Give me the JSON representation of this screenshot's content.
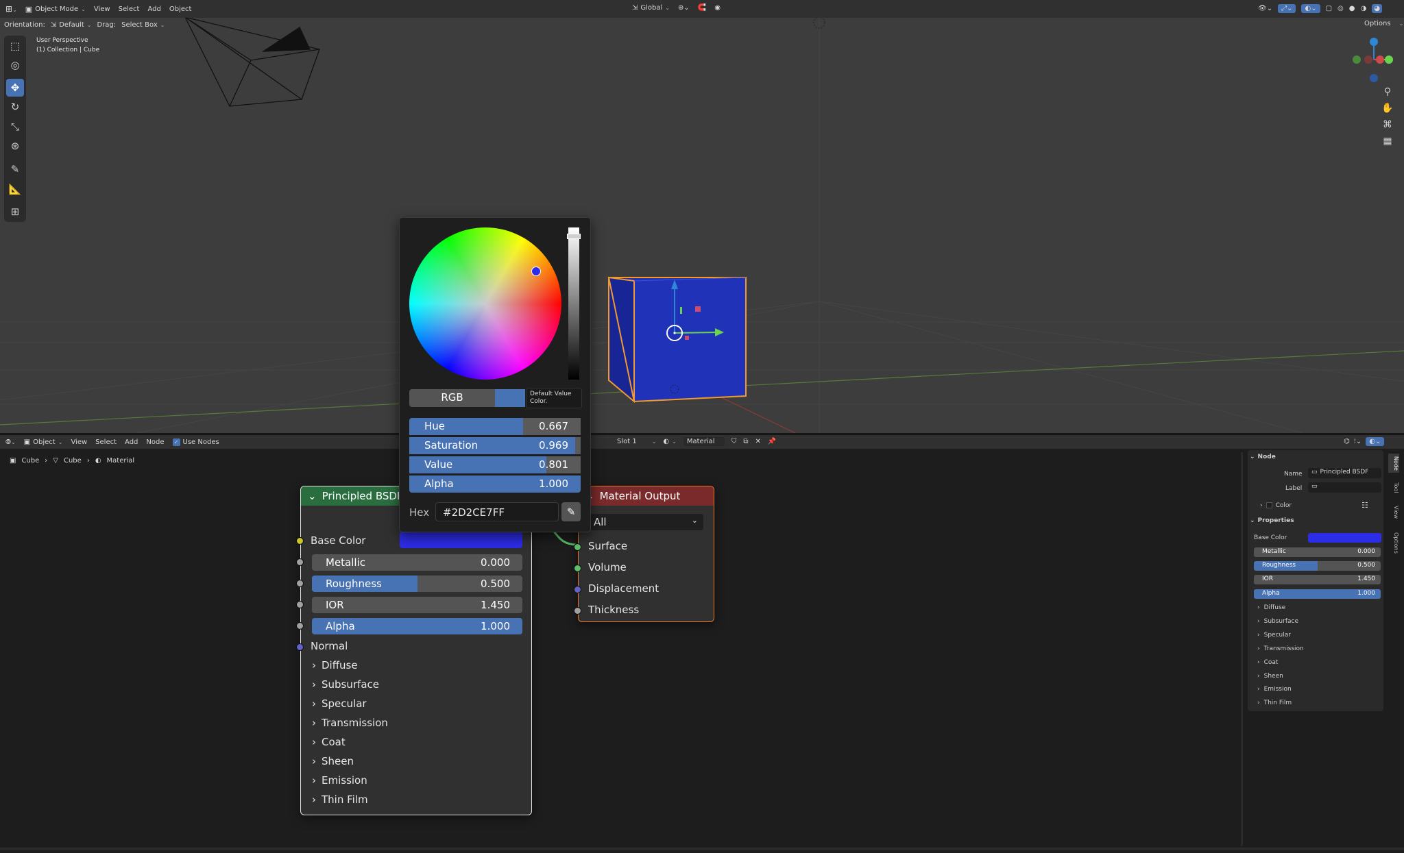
{
  "viewport_header": {
    "mode": "Object Mode",
    "menus": [
      "View",
      "Select",
      "Add",
      "Object"
    ],
    "transform_orientation": "Global"
  },
  "tool_settings": {
    "orientation_label": "Orientation:",
    "orientation_value": "Default",
    "drag_label": "Drag:",
    "drag_value": "Select Box",
    "options": "Options"
  },
  "viewport_overlay": {
    "perspective": "User Perspective",
    "collection": "(1) Collection | Cube"
  },
  "node_header": {
    "mode": "Object",
    "menus": [
      "View",
      "Select",
      "Add",
      "Node"
    ],
    "use_nodes": "Use Nodes",
    "slot": "Slot 1",
    "material": "Material"
  },
  "breadcrumb": [
    "Cube",
    "Cube",
    "Material"
  ],
  "bsdf_node": {
    "title": "Principled BSDF",
    "base_color": "Base Color",
    "sliders": [
      {
        "label": "Metallic",
        "value": "0.000",
        "fill": 0.0
      },
      {
        "label": "Roughness",
        "value": "0.500",
        "fill": 0.5
      },
      {
        "label": "IOR",
        "value": "1.450",
        "fill": 0.0
      },
      {
        "label": "Alpha",
        "value": "1.000",
        "fill": 1.0
      }
    ],
    "normal": "Normal",
    "panels": [
      "Diffuse",
      "Subsurface",
      "Specular",
      "Transmission",
      "Coat",
      "Sheen",
      "Emission",
      "Thin Film"
    ]
  },
  "output_node": {
    "title": "Material Output",
    "target": "All",
    "inputs": [
      "Surface",
      "Volume",
      "Displacement",
      "Thickness"
    ]
  },
  "color_picker": {
    "mode": "RGB",
    "tooltip_line1": "Default Value",
    "tooltip_line2": "Color.",
    "fields": [
      {
        "label": "Hue",
        "value": "0.667",
        "fill": 0.667
      },
      {
        "label": "Saturation",
        "value": "0.969",
        "fill": 0.969
      },
      {
        "label": "Value",
        "value": "0.801",
        "fill": 0.801
      },
      {
        "label": "Alpha",
        "value": "1.000",
        "fill": 1.0
      }
    ],
    "hex_label": "Hex",
    "hex_value": "#2D2CE7FF"
  },
  "sidebar": {
    "node_section": "Node",
    "name_label": "Name",
    "name_value": "Principled BSDF",
    "label_label": "Label",
    "color_section": "Color",
    "properties_section": "Properties",
    "base_color": "Base Color",
    "sliders": [
      {
        "label": "Metallic",
        "value": "0.000",
        "fill": 0.0
      },
      {
        "label": "Roughness",
        "value": "0.500",
        "fill": 0.5
      },
      {
        "label": "IOR",
        "value": "1.450",
        "fill": 0.0
      },
      {
        "label": "Alpha",
        "value": "1.000",
        "fill": 1.0
      }
    ],
    "panels": [
      "Diffuse",
      "Subsurface",
      "Specular",
      "Transmission",
      "Coat",
      "Sheen",
      "Emission",
      "Thin Film"
    ],
    "tabs": [
      "Node",
      "Tool",
      "View",
      "Options"
    ]
  },
  "colors": {
    "accent": "#4772b3",
    "base_color": "#2d2ce7",
    "bsdf_header": "#2a6e3f",
    "output_header": "#7a2a2a"
  }
}
